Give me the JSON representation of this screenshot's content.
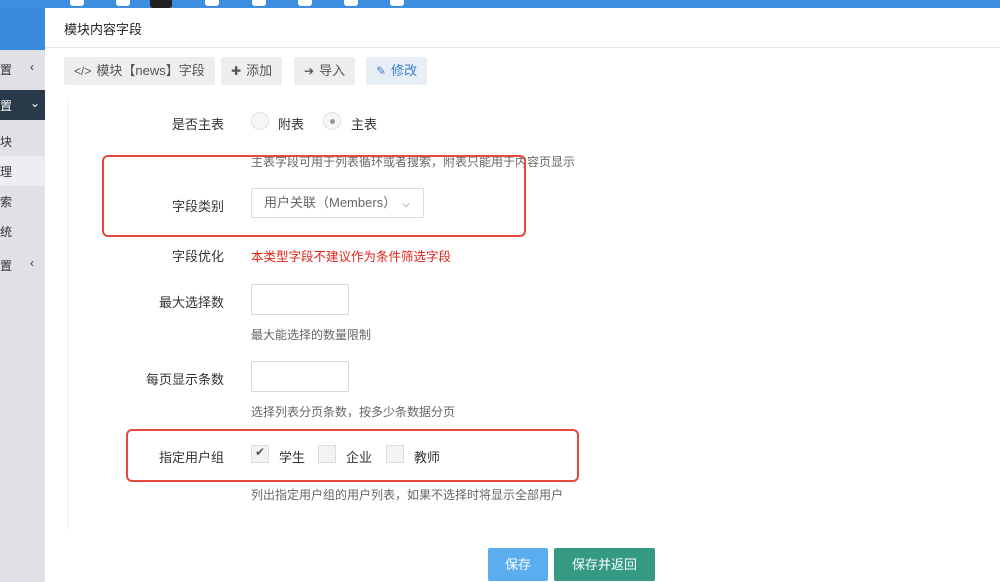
{
  "modal": {
    "title": "模块内容字段"
  },
  "toolbar": {
    "module_label": "模块【news】字段",
    "add_label": "添加",
    "import_label": "导入",
    "edit_label": "修改"
  },
  "sidebar": {
    "items": [
      {
        "label": "置",
        "chevron": "‹"
      },
      {
        "label": "置",
        "chevron": "⌄"
      },
      {
        "label": "块"
      },
      {
        "label": "理"
      },
      {
        "label": "索"
      },
      {
        "label": "统"
      },
      {
        "label": "置",
        "chevron": "‹"
      }
    ]
  },
  "form": {
    "is_main_table": {
      "label": "是否主表",
      "option_attached": "附表",
      "option_main": "主表",
      "selected": "主表",
      "help": "主表字段可用于列表循环或者搜索，附表只能用于内容页显示"
    },
    "field_type": {
      "label": "字段类别",
      "value": "用户关联（Members）"
    },
    "field_optimize": {
      "label": "字段优化",
      "warning": "本类型字段不建议作为条件筛选字段"
    },
    "max_select": {
      "label": "最大选择数",
      "value": "",
      "help": "最大能选择的数量限制"
    },
    "per_page": {
      "label": "每页显示条数",
      "value": "",
      "help": "选择列表分页条数，按多少条数据分页"
    },
    "user_group": {
      "label": "指定用户组",
      "options": [
        {
          "label": "学生",
          "checked": true
        },
        {
          "label": "企业",
          "checked": false
        },
        {
          "label": "教师",
          "checked": false
        }
      ],
      "help": "列出指定用户组的用户列表，如果不选择时将显示全部用户"
    }
  },
  "footer": {
    "save_label": "保存",
    "save_back_label": "保存并返回"
  },
  "colors": {
    "primary": "#5aaef0",
    "success": "#349a84",
    "danger": "#e0241b",
    "highlight": "#e5493c"
  }
}
